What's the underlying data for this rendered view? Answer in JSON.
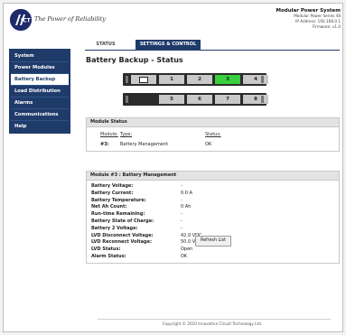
{
  "header": {
    "tagline": "The Power of Reliability",
    "system_title": "Modular Power System",
    "lines": [
      "Modular Power Series 48",
      "IP Address: 192.168.0.1",
      "Firmware: v1.0"
    ]
  },
  "nav": {
    "items": [
      {
        "label": "System",
        "active": false
      },
      {
        "label": "Power Modules",
        "active": false
      },
      {
        "label": "Battery Backup",
        "active": true
      },
      {
        "label": "Load Distribution",
        "active": false
      },
      {
        "label": "Alarms",
        "active": false
      },
      {
        "label": "Communications",
        "active": false
      },
      {
        "label": "Help",
        "active": false
      }
    ]
  },
  "tabs": {
    "status": "STATUS",
    "settings": "SETTINGS & CONTROL"
  },
  "page_title": "Battery Backup - Status",
  "rack": {
    "slots": [
      "1",
      "2",
      "3",
      "4",
      "5",
      "6",
      "7",
      "8"
    ],
    "active_slot": "3",
    "active_color": "#39d03d"
  },
  "module_status": {
    "title": "Module Status",
    "headers": {
      "module": "Module:",
      "type": "Type:",
      "status": "Status:"
    },
    "row": {
      "module": "#3:",
      "type": "Battery Management",
      "status": "OK"
    }
  },
  "module_detail": {
    "title": "Module #3 : Battery Management",
    "rows": [
      {
        "label": "Battery Voltage:",
        "value": "-"
      },
      {
        "label": "Battery Current:",
        "value": "0.0 A"
      },
      {
        "label": "Battery Temperature:",
        "value": "-"
      },
      {
        "label": "Net Ah Count:",
        "value": "0 Ah"
      },
      {
        "label": "Run-time Remaining:",
        "value": "-"
      },
      {
        "label": "Battery State of Charge:",
        "value": "-"
      },
      {
        "label": "Battery 2 Voltage:",
        "value": "-"
      },
      {
        "label": "LVD Disconnect Voltage:",
        "value": "42.0 VDC"
      },
      {
        "label": "LVD Reconnect Voltage:",
        "value": "50.0 VDC"
      },
      {
        "label": "LVD Status:",
        "value": "Open"
      },
      {
        "label": "Alarm Status:",
        "value": "OK"
      }
    ]
  },
  "refresh_label": "Refresh List",
  "footer": "Copyright © 2010 Innovative Circuit Technology Ltd.",
  "colors": {
    "nav_bg": "#1f3b6a",
    "active_module": "#39d03d",
    "panel_head": "#e3e3e3"
  }
}
